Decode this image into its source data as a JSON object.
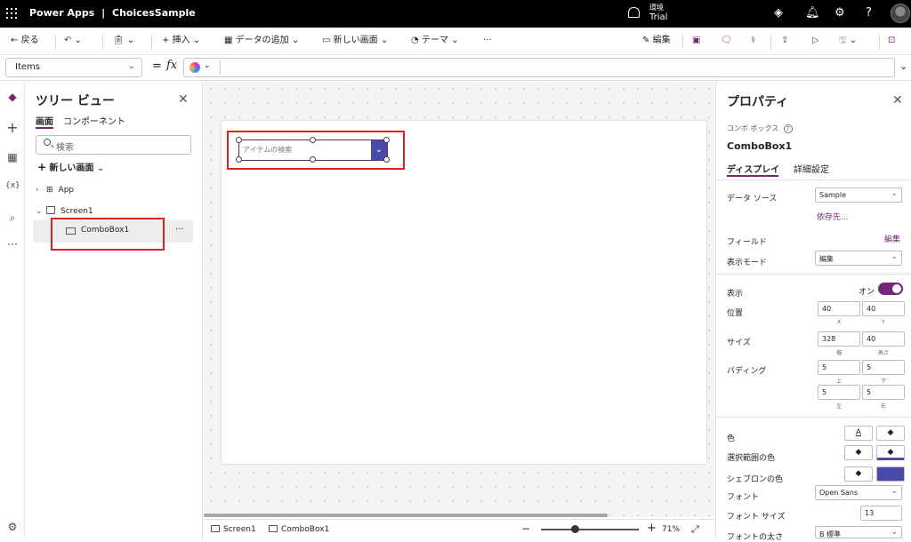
{
  "app": {
    "brand": "Power Apps",
    "sep": "|",
    "app_name": "ChoicesSample"
  },
  "environment": {
    "label": "環境",
    "name": "Trial"
  },
  "toolbar": {
    "back": "戻る",
    "insert": "挿入",
    "add_data": "データの追加",
    "new_screen": "新しい画面",
    "theme": "テーマ",
    "more": "···",
    "edit": "編集"
  },
  "formula_bar": {
    "property": "Items",
    "eq": "=",
    "fx": "fx",
    "formula": ""
  },
  "tree": {
    "title": "ツリー ビュー",
    "tabs": [
      "画面",
      "コンポーネント"
    ],
    "search_placeholder": "検索",
    "new_screen": "新しい画面",
    "nodes": [
      {
        "label": "App"
      },
      {
        "label": "Screen1"
      },
      {
        "label": "ComboBox1"
      }
    ],
    "more": "···"
  },
  "canvas": {
    "combo_placeholder": "アイテムの検索",
    "zoom": "71%",
    "breadcrumb": [
      "Screen1",
      "ComboBox1"
    ]
  },
  "properties": {
    "title": "プロパティ",
    "type_label": "コンボ ボックス",
    "control_name": "ComboBox1",
    "tabs": [
      "ディスプレイ",
      "詳細設定"
    ],
    "datasource_label": "データ ソース",
    "datasource_value": "Sample",
    "depends_link": "依存先...",
    "fields_label": "フィールド",
    "fields_edit": "編集",
    "display_mode_label": "表示モード",
    "display_mode_value": "編集",
    "visible_label": "表示",
    "visible_value": "オン",
    "position_label": "位置",
    "position": {
      "x": "40",
      "y": "40",
      "x_label": "X",
      "y_label": "Y"
    },
    "size_label": "サイズ",
    "size": {
      "w": "328",
      "h": "40",
      "w_label": "幅",
      "h_label": "高さ"
    },
    "padding_label": "パディング",
    "padding": {
      "top": "5",
      "bottom": "5",
      "left": "5",
      "right": "5",
      "top_label": "上",
      "bottom_label": "下",
      "left_label": "左",
      "right_label": "右"
    },
    "color_label": "色",
    "selection_color_label": "選択範囲の色",
    "chevron_color_label": "シェブロンの色",
    "font_label": "フォント",
    "font_value": "Open Sans",
    "font_size_label": "フォント サイズ",
    "font_size_value": "13",
    "font_weight_label": "フォントの太さ",
    "font_weight_value": "B 標準",
    "color_a": "A"
  },
  "colors": {
    "accent": "#742774",
    "chevron_fill": "#4a4aa8",
    "highlight": "#e02020"
  }
}
